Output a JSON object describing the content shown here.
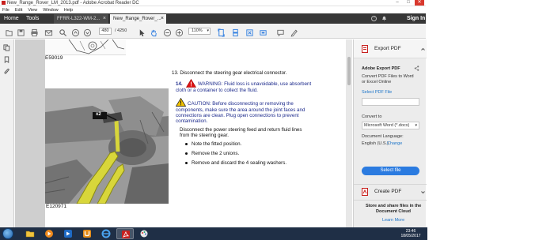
{
  "window": {
    "title": "New_Range_Rover_LM_2013.pdf - Adobe Acrobat Reader DC",
    "minimize": "–",
    "maximize": "□",
    "close": "✕"
  },
  "menubar": {
    "items": [
      "File",
      "Edit",
      "View",
      "Window",
      "Help"
    ]
  },
  "tabs": {
    "home": "Home",
    "tools": "Tools",
    "doc_tabs": [
      {
        "label": "FFRR-L322-WM-2...",
        "close": "×"
      },
      {
        "label": "New_Range_Rover_...",
        "close": "×"
      }
    ],
    "sign_in": "Sign In"
  },
  "toolbar": {
    "page_current": "480",
    "page_total": "/ 4250",
    "zoom": "110%"
  },
  "document": {
    "figure_top_label": "E59019",
    "figure_bottom_label": "E120971",
    "callout": "x2",
    "step13": "13. Disconnect the steering gear electrical connector.",
    "step14_num": "14.",
    "warning_line1": "WARNING: Fluid loss is unavoidable, use absorbent",
    "warning_line2": "cloth or a container to collect the fluid.",
    "caution_line1": "CAUTION: Before disconnecting or removing the",
    "caution_line2": "components, make sure the area around the joint faces and",
    "caution_line3": "connections are clean. Plug open connections to prevent",
    "caution_line4": "contamination.",
    "body_line1": "Disconnect the power steering feed and return fluid lines",
    "body_line2": "from the steering gear.",
    "bullets": [
      "Note the fitted position.",
      "Remove the 2 unions.",
      "Remove and discard the 4 sealing washers."
    ]
  },
  "right_pane": {
    "export_title": "Export PDF",
    "export_heading": "Adobe Export PDF",
    "export_desc_1": "Convert PDF Files to Word",
    "export_desc_2": "or Excel Online",
    "select_pdf_link": "Select PDF File",
    "convert_to_label": "Convert to",
    "convert_to_value": "Microsoft Word (*.docx)",
    "doc_lang_label": "Document Language:",
    "doc_lang_value": "English (U.S.)",
    "change_link": "Change",
    "select_file_button": "Select file",
    "create_pdf_title": "Create PDF",
    "store_1": "Store and share files in the",
    "store_2": "Document Cloud",
    "learn_more": "Learn More"
  },
  "taskbar": {
    "time": "23:46",
    "date": "18/05/2017"
  },
  "colors": {
    "tabbar_bg": "#373737",
    "accent_blue": "#2b7be0",
    "warning_text": "#1c2a8c",
    "taskbar_bg": "#1f2f46",
    "acrobat_red": "#c8201e"
  }
}
